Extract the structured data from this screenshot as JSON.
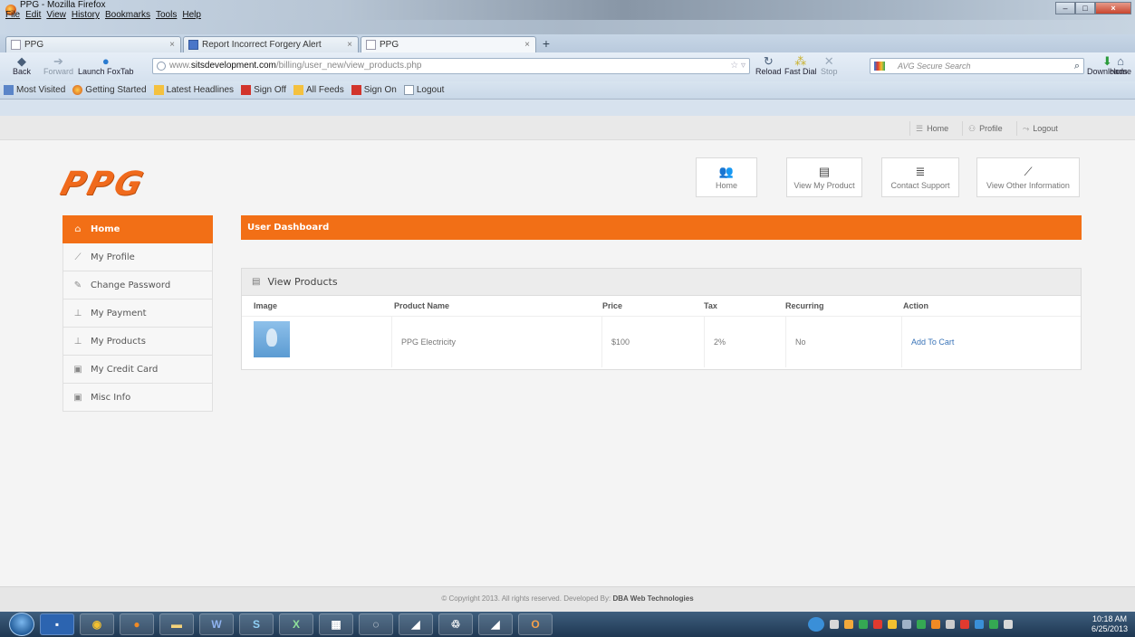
{
  "browser": {
    "window_title": "PPG - Mozilla Firefox",
    "menu": [
      "File",
      "Edit",
      "View",
      "History",
      "Bookmarks",
      "Tools",
      "Help"
    ],
    "tabs": [
      {
        "label": "PPG",
        "favicon": "blank-page-icon"
      },
      {
        "label": "Report Incorrect Forgery Alert",
        "favicon": "google-icon"
      },
      {
        "label": "PPG",
        "favicon": "blank-page-icon"
      }
    ],
    "nav": {
      "back": "Back",
      "forward": "Forward",
      "launch_foxtab": "Launch FoxTab",
      "reload": "Reload",
      "fast_dial": "Fast Dial",
      "stop": "Stop",
      "downloads": "Downloads",
      "home": "Home"
    },
    "url": {
      "prefix": "www.",
      "domain": "sitsdevelopment.com",
      "path": "/billing/user_new/view_products.php"
    },
    "search_placeholder": "AVG Secure Search",
    "bookmarks": [
      "Most Visited",
      "Getting Started",
      "Latest Headlines",
      "Sign Off",
      "All Feeds",
      "Sign On",
      "Logout"
    ]
  },
  "site": {
    "logo_text": "PPG",
    "top_links": [
      "Home",
      "Profile",
      "Logout"
    ],
    "quick_buttons": [
      "Home",
      "View My Product",
      "Contact Support",
      "View Other Information"
    ],
    "sidebar": [
      {
        "label": "Home",
        "icon": "home-icon"
      },
      {
        "label": "My Profile",
        "icon": "chart-icon"
      },
      {
        "label": "Change Password",
        "icon": "pencil-icon"
      },
      {
        "label": "My Payment",
        "icon": "upload-icon"
      },
      {
        "label": "My Products",
        "icon": "upload-icon"
      },
      {
        "label": "My Credit Card",
        "icon": "calendar-icon"
      },
      {
        "label": "Misc Info",
        "icon": "calendar-icon"
      }
    ],
    "dashboard_title": "User Dashboard",
    "panel_title": "View Products",
    "table": {
      "headers": [
        "Image",
        "Product Name",
        "Price",
        "Tax",
        "Recurring",
        "Action"
      ],
      "rows": [
        {
          "product": "PPG Electricity",
          "price": "$100",
          "tax": "2%",
          "recurring": "No",
          "action": "Add To Cart"
        }
      ]
    },
    "footer": {
      "text": "© Copyright 2013. All rights reserved. Developed By: ",
      "developer": "DBA Web Technologies"
    },
    "accent_color": "#f26f16"
  },
  "taskbar": {
    "time": "10:18 AM",
    "date": "6/25/2013"
  }
}
